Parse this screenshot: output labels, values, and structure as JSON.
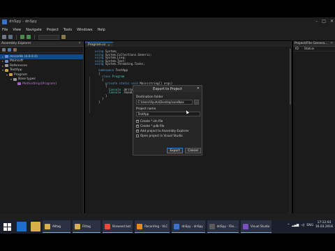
{
  "window": {
    "title": "dnSpy - dnSpy",
    "menu": [
      "File",
      "View",
      "Navigate",
      "Project",
      "Tools",
      "Windows",
      "Help"
    ]
  },
  "left_pane": {
    "title": "Assembly Explorer",
    "tree": [
      {
        "label": "mscorlib (4.0.0.0)",
        "expander": "▸",
        "selected": true
      },
      {
        "label": "Mainsoft",
        "expander": "▸"
      },
      {
        "label": "References",
        "expander": "▸"
      },
      {
        "label": "TestApp",
        "expander": "▾"
      },
      {
        "label": "Program",
        "expander": "▾"
      },
      {
        "label": "Base types",
        "expander": "▾"
      },
      {
        "label": "MethodImpl(Program)",
        "expander": ""
      }
    ]
  },
  "editor": {
    "tab_label": "Program.cs",
    "code_lines": [
      {
        "indent": 0,
        "tokens": [
          [
            "kw",
            "using"
          ],
          [
            "",
            "System;"
          ]
        ]
      },
      {
        "indent": 0,
        "tokens": [
          [
            "kw",
            "using"
          ],
          [
            "",
            "System.Collections.Generic;"
          ]
        ]
      },
      {
        "indent": 0,
        "tokens": [
          [
            "kw",
            "using"
          ],
          [
            "",
            "System.Linq;"
          ]
        ]
      },
      {
        "indent": 0,
        "tokens": [
          [
            "kw",
            "using"
          ],
          [
            "",
            "System.Text;"
          ]
        ]
      },
      {
        "indent": 0,
        "tokens": [
          [
            "kw",
            "using"
          ],
          [
            "",
            "System.Threading.Tasks;"
          ]
        ]
      },
      {
        "indent": 0,
        "tokens": []
      },
      {
        "indent": 1,
        "tokens": [
          [
            "kw",
            "namespace"
          ],
          [
            "",
            "TestApp"
          ]
        ]
      },
      {
        "indent": 1,
        "tokens": [
          [
            "",
            "{"
          ]
        ]
      },
      {
        "indent": 2,
        "tokens": [
          [
            "kw",
            "class"
          ],
          [
            "ty",
            "Program"
          ]
        ]
      },
      {
        "indent": 2,
        "tokens": [
          [
            "",
            "{"
          ]
        ]
      },
      {
        "indent": 3,
        "tokens": [
          [
            "kw",
            "private"
          ],
          [
            "kw",
            "static"
          ],
          [
            "kw",
            "void"
          ],
          [
            "",
            "Main(string[] args)"
          ]
        ]
      },
      {
        "indent": 3,
        "tokens": [
          [
            "",
            "{"
          ]
        ]
      },
      {
        "indent": 4,
        "tokens": [
          [
            "ty",
            "Console"
          ],
          [
            "",
            ".WriteLine(...);"
          ]
        ]
      },
      {
        "indent": 4,
        "tokens": [
          [
            "ty",
            "Console"
          ],
          [
            "",
            ".ReadLine();"
          ]
        ]
      },
      {
        "indent": 3,
        "tokens": [
          [
            "",
            "}"
          ]
        ]
      },
      {
        "indent": 2,
        "tokens": [
          [
            "",
            "}"
          ]
        ]
      },
      {
        "indent": 1,
        "tokens": [
          [
            "",
            "}"
          ]
        ]
      }
    ]
  },
  "right_pane": {
    "title": "Project/File Genera...",
    "col1": "ID",
    "col2": "Status"
  },
  "dialog": {
    "title": "Export to Project",
    "folder_label": "Destination folder",
    "folder_value": "C:\\Users\\Ilyuha\\Desktop\\sandbox",
    "browse_label": "...",
    "name_label": "Project name",
    "name_value": "TestApp",
    "checks": [
      {
        "label": "Create *.sln file",
        "checked": true
      },
      {
        "label": "Create *.pdb file",
        "checked": true
      },
      {
        "label": "Add project to Assembly Explorer",
        "checked": true
      },
      {
        "label": "Open project in Visual Studio",
        "checked": false
      }
    ],
    "ok_label": "Export",
    "cancel_label": "Cancel"
  },
  "taskbar": {
    "buttons": [
      {
        "label": "Alltag",
        "color": "#d8b04a"
      },
      {
        "label": "Fittag",
        "color": "#d8b04a"
      },
      {
        "label": "Browsed bot",
        "color": "#e34b3a"
      },
      {
        "label": "Recording - VLC",
        "color": "#e8871e"
      },
      {
        "label": "dnSpy - dnSpy",
        "color": "#3a72c8"
      },
      {
        "label": "dnSpy - File...",
        "color": "#5a5a5a"
      },
      {
        "label": "Visual Studio",
        "color": "#7a4fbf"
      }
    ],
    "time": "17:12:03",
    "date": "16.03.2016",
    "lang": "ENG"
  },
  "colors": {
    "accent": "#3a72c8",
    "selection": "#0f4a88"
  }
}
